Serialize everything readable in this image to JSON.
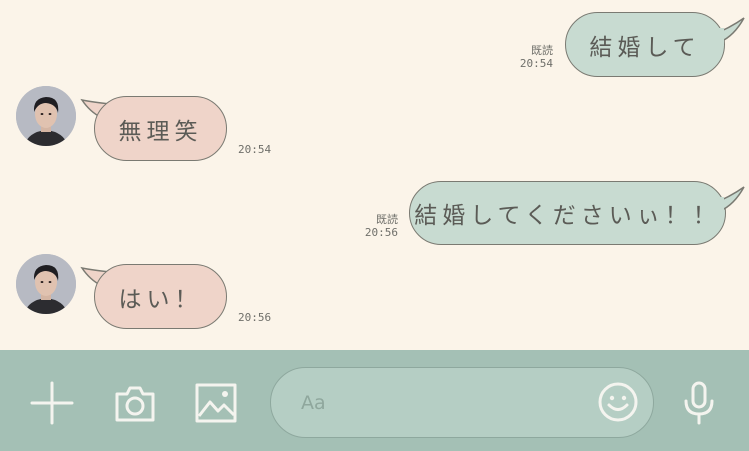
{
  "messages": [
    {
      "side": "sent",
      "text": "結婚して",
      "read": "既読",
      "time": "20:54"
    },
    {
      "side": "received",
      "text": "無理笑",
      "time": "20:54"
    },
    {
      "side": "sent",
      "text": "結婚してくださいぃ！！",
      "read": "既読",
      "time": "20:56"
    },
    {
      "side": "received",
      "text": "はい！",
      "time": "20:56"
    }
  ],
  "input_bar": {
    "placeholder": "Aa",
    "icons": [
      "plus-icon",
      "camera-icon",
      "image-icon",
      "smiley-icon",
      "microphone-icon"
    ]
  },
  "colors": {
    "chat_background": "#fbf4e9",
    "sent_bubble": "#c8dbd1",
    "received_bubble": "#efd4c9",
    "input_bar": "#a4c0b5",
    "icon": "#f4f4ef"
  }
}
